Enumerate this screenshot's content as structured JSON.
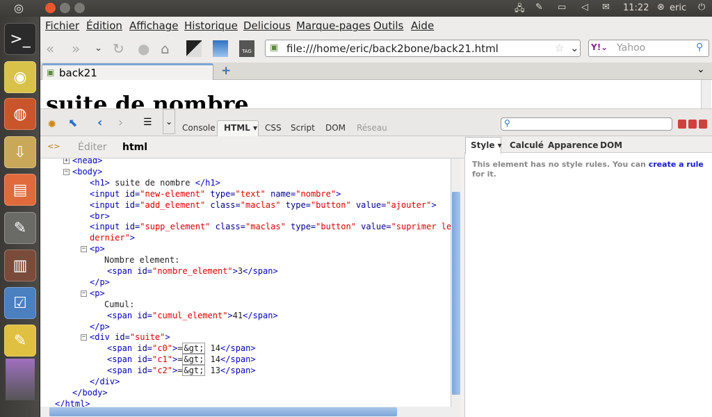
{
  "panel": {
    "clock": "11:22",
    "user": "eric"
  },
  "launcher": {
    "items": [
      "terminal",
      "rhythmbox",
      "firefox",
      "archive-manager",
      "file-manager",
      "text-editor",
      "library",
      "task-manager",
      "workspaces"
    ]
  },
  "menu": [
    "Fichier",
    "Édition",
    "Affichage",
    "Historique",
    "Delicious",
    "Marque-pages",
    "Outils",
    "Aide"
  ],
  "nav": {
    "url": "file:///home/eric/back2bone/back21.html",
    "search_placeholder": "Yahoo"
  },
  "tab": {
    "title": "back21"
  },
  "page": {
    "heading": "suite de nombre"
  },
  "firebug": {
    "tabs": [
      "Console",
      "HTML ▾",
      "CSS",
      "Script",
      "DOM",
      "Réseau"
    ],
    "active_tab": 1,
    "edit": "Éditer",
    "breadcrumb": "html",
    "side_tabs": [
      "Style ▾",
      "Calculé",
      "Apparence",
      "DOM"
    ],
    "side_msg": "This element has no style rules. You can ",
    "side_link": "create a rule",
    "side_msg2": "for it."
  },
  "code": [
    {
      "x": 46,
      "tog": "+",
      "parts": [
        [
          "tg",
          "<head>"
        ]
      ]
    },
    {
      "x": 46,
      "tog": "−",
      "parts": [
        [
          "tg",
          "<body>"
        ]
      ]
    },
    {
      "x": 71,
      "parts": [
        [
          "tg",
          "<h1>"
        ],
        [
          "tx",
          " suite de nombre "
        ],
        [
          "tg",
          "</h1>"
        ]
      ]
    },
    {
      "x": 71,
      "parts": [
        [
          "tg",
          "<input "
        ],
        [
          "at",
          "id="
        ],
        [
          "vl",
          "\"new-element\""
        ],
        [
          "at",
          " type="
        ],
        [
          "vl",
          "\"text\""
        ],
        [
          "at",
          " name="
        ],
        [
          "vl",
          "\"nombre\""
        ],
        [
          "tg",
          ">"
        ]
      ]
    },
    {
      "x": 71,
      "parts": [
        [
          "tg",
          "<input "
        ],
        [
          "at",
          "id="
        ],
        [
          "vl",
          "\"add_element\""
        ],
        [
          "at",
          " class="
        ],
        [
          "vl",
          "\"maclas\""
        ],
        [
          "at",
          " type="
        ],
        [
          "vl",
          "\"button\""
        ],
        [
          "at",
          " value="
        ],
        [
          "vl",
          "\"ajouter\""
        ],
        [
          "tg",
          ">"
        ]
      ]
    },
    {
      "x": 71,
      "parts": [
        [
          "tg",
          "<br>"
        ]
      ]
    },
    {
      "x": 71,
      "parts": [
        [
          "tg",
          "<input "
        ],
        [
          "at",
          "id="
        ],
        [
          "vl",
          "\"supp_element\""
        ],
        [
          "at",
          " class="
        ],
        [
          "vl",
          "\"maclas\""
        ],
        [
          "at",
          " type="
        ],
        [
          "vl",
          "\"button\""
        ],
        [
          "at",
          " value="
        ],
        [
          "vl",
          "\"suprimer le"
        ]
      ]
    },
    {
      "x": 71,
      "parts": [
        [
          "vl",
          "dernier\""
        ],
        [
          "tg",
          ">"
        ]
      ]
    },
    {
      "x": 71,
      "tog": "−",
      "parts": [
        [
          "tg",
          "<p>"
        ]
      ]
    },
    {
      "x": 92,
      "parts": [
        [
          "tx",
          "Nombre element:"
        ]
      ]
    },
    {
      "x": 96,
      "parts": [
        [
          "tg",
          "<span "
        ],
        [
          "at",
          "id="
        ],
        [
          "vl",
          "\"nombre_element\""
        ],
        [
          "tg",
          ">"
        ],
        [
          "tx",
          "3"
        ],
        [
          "tg",
          "</span>"
        ]
      ]
    },
    {
      "x": 71,
      "parts": [
        [
          "tg",
          "</p>"
        ]
      ]
    },
    {
      "x": 71,
      "tog": "−",
      "parts": [
        [
          "tg",
          "<p>"
        ]
      ]
    },
    {
      "x": 92,
      "parts": [
        [
          "tx",
          "Cumul:"
        ]
      ]
    },
    {
      "x": 96,
      "parts": [
        [
          "tg",
          "<span "
        ],
        [
          "at",
          "id="
        ],
        [
          "vl",
          "\"cumul_element\""
        ],
        [
          "tg",
          ">"
        ],
        [
          "tx",
          "41"
        ],
        [
          "tg",
          "</span>"
        ]
      ]
    },
    {
      "x": 71,
      "parts": [
        [
          "tg",
          "</p>"
        ]
      ]
    },
    {
      "x": 71,
      "tog": "−",
      "parts": [
        [
          "tg",
          "<div "
        ],
        [
          "at",
          "id="
        ],
        [
          "vl",
          "\"suite\""
        ],
        [
          "tg",
          ">"
        ]
      ]
    },
    {
      "x": 96,
      "parts": [
        [
          "tg",
          "<span "
        ],
        [
          "at",
          "id="
        ],
        [
          "vl",
          "\"c0\""
        ],
        [
          "tg",
          ">"
        ],
        [
          "tx",
          "="
        ],
        [
          "ent",
          "&gt;"
        ],
        [
          "tx",
          " 14"
        ],
        [
          "tg",
          "</span>"
        ]
      ]
    },
    {
      "x": 96,
      "parts": [
        [
          "tg",
          "<span "
        ],
        [
          "at",
          "id="
        ],
        [
          "vl",
          "\"c1\""
        ],
        [
          "tg",
          ">"
        ],
        [
          "tx",
          "="
        ],
        [
          "ent",
          "&gt;"
        ],
        [
          "tx",
          " 14"
        ],
        [
          "tg",
          "</span>"
        ]
      ]
    },
    {
      "x": 96,
      "parts": [
        [
          "tg",
          "<span "
        ],
        [
          "at",
          "id="
        ],
        [
          "vl",
          "\"c2\""
        ],
        [
          "tg",
          ">"
        ],
        [
          "tx",
          "="
        ],
        [
          "ent",
          "&gt;"
        ],
        [
          "tx",
          " 13"
        ],
        [
          "tg",
          "</span>"
        ]
      ]
    },
    {
      "x": 71,
      "parts": [
        [
          "tg",
          "</div>"
        ]
      ]
    },
    {
      "x": 46,
      "parts": [
        [
          "tg",
          "</body>"
        ]
      ]
    },
    {
      "x": 21,
      "parts": [
        [
          "tg",
          "</html>"
        ]
      ]
    }
  ]
}
